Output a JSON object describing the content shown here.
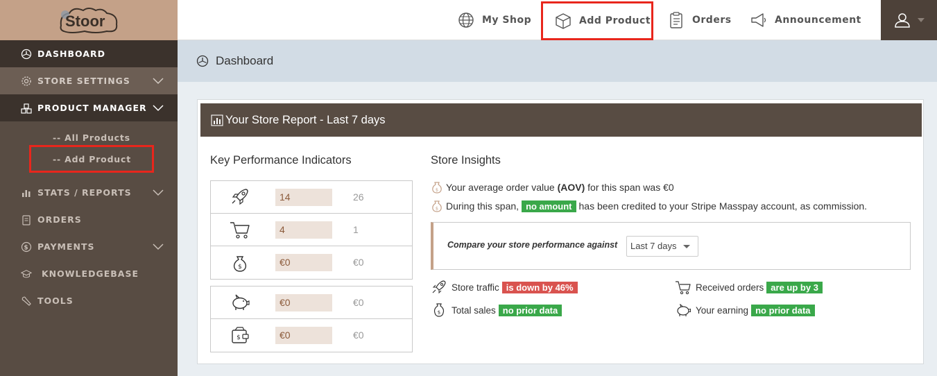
{
  "brand": {
    "logo_text": "Stoor"
  },
  "topnav": {
    "my_shop": "My Shop",
    "add_product": "Add Product",
    "orders": "Orders",
    "announcement": "Announcement"
  },
  "sidebar": {
    "dashboard": "DASHBOARD",
    "store_settings": "STORE SETTINGS",
    "product_manager": "PRODUCT MANAGER",
    "all_products": "-- All Products",
    "add_product": "-- Add Product",
    "stats_reports": "STATS / REPORTS",
    "orders": "ORDERS",
    "payments": "PAYMENTS",
    "knowledgebase": "KNOWLEDGEBASE",
    "tools": "TOOLS"
  },
  "breadcrumb": {
    "title": "Dashboard"
  },
  "report": {
    "title": "Your Store Report - Last 7 days",
    "kpi_title": "Key Performance Indicators",
    "kpi_rows": [
      {
        "icon": "rocket-icon",
        "current": "14",
        "previous": "26"
      },
      {
        "icon": "cart-icon",
        "current": "4",
        "previous": "1"
      },
      {
        "icon": "money-bag-icon",
        "current": "€0",
        "previous": "€0"
      },
      {
        "icon": "piggy-bank-icon",
        "current": "€0",
        "previous": "€0"
      },
      {
        "icon": "wallet-icon",
        "current": "€0",
        "previous": "€0"
      }
    ],
    "insights_title": "Store Insights",
    "aov_prefix": "Your average order value ",
    "aov_bold": "(AOV)",
    "aov_suffix": " for this span was €0",
    "commission_prefix": "During this span,",
    "commission_badge": "no amount",
    "commission_suffix": "has been credited to your Stripe Masspay account, as commission.",
    "compare_label": "Compare your store performance against",
    "compare_value": "Last 7 days",
    "stats": {
      "traffic_label": "Store traffic",
      "traffic_badge": "is down by 46%",
      "orders_label": "Received orders",
      "orders_badge": "are up by 3",
      "sales_label": "Total sales",
      "sales_badge": "no prior data",
      "earning_label": "Your earning",
      "earning_badge": "no prior data"
    }
  },
  "colors": {
    "sidebar_bg": "#584c43",
    "sidebar_active": "#3b322c",
    "logo_bg": "#c4a188",
    "highlight_red": "#e8261c",
    "badge_green": "#3aa84a",
    "badge_red": "#d9534f"
  }
}
